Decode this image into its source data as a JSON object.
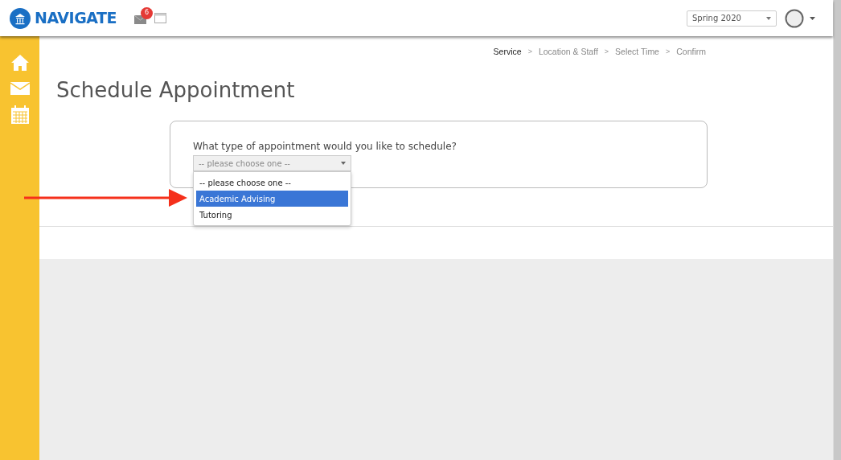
{
  "header": {
    "logo": "NAVIGATE",
    "mail_badge": "6",
    "term_select": "Spring 2020"
  },
  "steps": [
    {
      "label": "Service",
      "selected": true
    },
    {
      "label": "Location & Staff",
      "selected": false
    },
    {
      "label": "Select Time",
      "selected": false
    },
    {
      "label": "Confirm",
      "selected": false
    }
  ],
  "step_separator": ">",
  "page_title": "Schedule Appointment",
  "form": {
    "question": "What type of appointment would you like to schedule?",
    "select_placeholder": "-- please choose one --",
    "options": [
      {
        "label": "-- please choose one --",
        "selected": false
      },
      {
        "label": "Academic Advising",
        "selected": true
      },
      {
        "label": "Tutoring",
        "selected": false
      }
    ]
  }
}
